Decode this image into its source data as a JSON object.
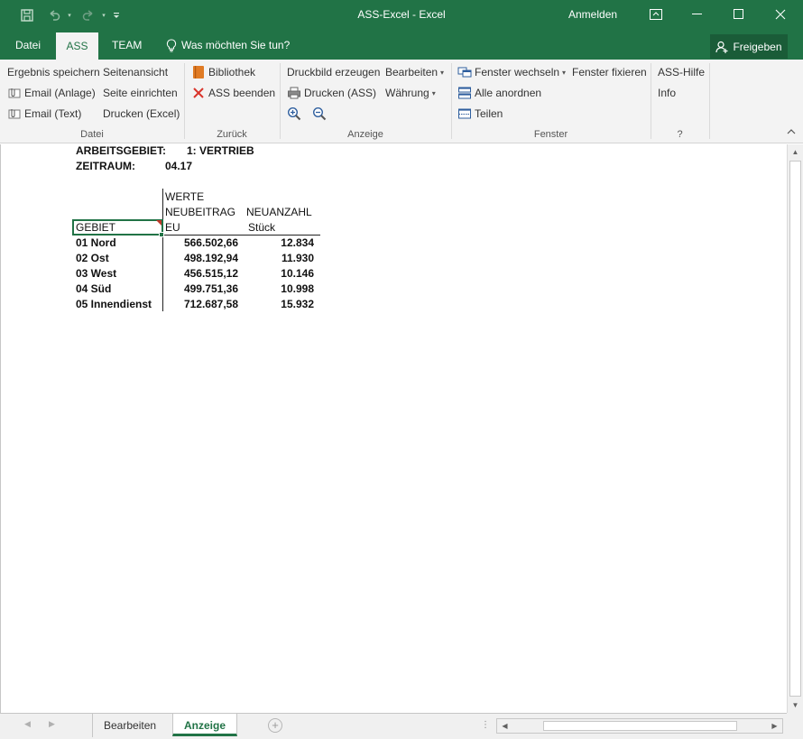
{
  "window": {
    "title": "ASS-Excel  -  Excel",
    "sign_in": "Anmelden"
  },
  "tabs": {
    "file": "Datei",
    "ass": "ASS",
    "team": "TEAM",
    "tell_me": "Was möchten Sie tun?",
    "share": "Freigeben"
  },
  "ribbon": {
    "datei": {
      "label": "Datei",
      "save_result": "Ergebnis speichern",
      "page_view": "Seitenansicht",
      "email_attach": "Email (Anlage)",
      "page_setup": "Seite einrichten",
      "email_text": "Email (Text)",
      "print_excel": "Drucken (Excel)"
    },
    "zurueck": {
      "label": "Zurück",
      "library": "Bibliothek",
      "exit_ass": "ASS beenden"
    },
    "anzeige": {
      "label": "Anzeige",
      "print_preview": "Druckbild erzeugen",
      "edit": "Bearbeiten",
      "print_ass": "Drucken (ASS)",
      "currency": "Währung"
    },
    "fenster": {
      "label": "Fenster",
      "switch_window": "Fenster wechseln",
      "freeze": "Fenster fixieren",
      "arrange_all": "Alle anordnen",
      "split": "Teilen"
    },
    "help": {
      "label": "?",
      "ass_help": "ASS-Hilfe",
      "info": "Info"
    }
  },
  "sheet": {
    "area_label": "ARBEITSGEBIET:",
    "area_value": "1: VERTRIEB",
    "period_label": "ZEITRAUM:",
    "period_value": "04.17",
    "values_header": "WERTE",
    "col1_header": "NEUBEITRAG",
    "col1_unit": "EU",
    "col2_header": "NEUANZAHL",
    "col2_unit": "Stück",
    "row_header": "GEBIET",
    "rows": [
      {
        "region": "01 Nord",
        "beitrag": "566.502,66",
        "anzahl": "12.834"
      },
      {
        "region": "02 Ost",
        "beitrag": "498.192,94",
        "anzahl": "11.930"
      },
      {
        "region": "03 West",
        "beitrag": "456.515,12",
        "anzahl": "10.146"
      },
      {
        "region": "04 Süd",
        "beitrag": "499.751,36",
        "anzahl": "10.998"
      },
      {
        "region": "05 Innendienst",
        "beitrag": "712.687,58",
        "anzahl": "15.932"
      }
    ]
  },
  "sheet_tabs": {
    "tab1": "Bearbeiten",
    "tab2": "Anzeige",
    "active": "Anzeige"
  },
  "colors": {
    "accent": "#217346",
    "share_button": "#1a5c38",
    "ribbon_bg": "#f3f3f3"
  }
}
